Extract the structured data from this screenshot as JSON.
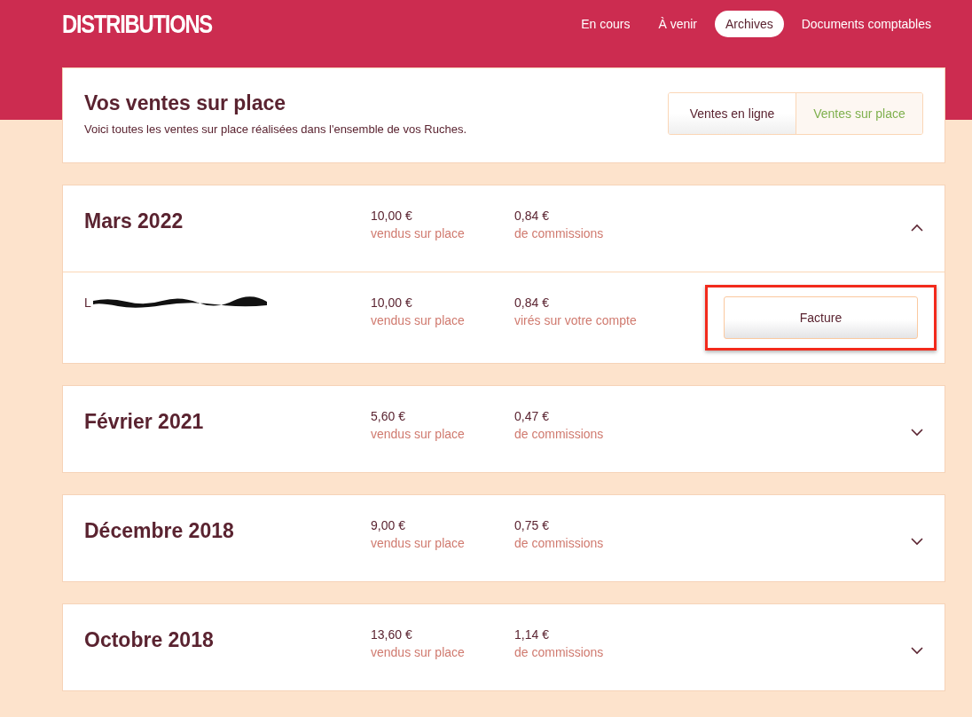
{
  "brand": "DISTRIBUTIONS",
  "nav": [
    {
      "label": "En cours",
      "selected": false
    },
    {
      "label": "À venir",
      "selected": false
    },
    {
      "label": "Archives",
      "selected": true
    },
    {
      "label": "Documents comptables",
      "selected": false
    }
  ],
  "intro": {
    "title": "Vos ventes sur place",
    "text": "Voici toutes les ventes sur place réalisées dans l'ensemble de vos Ruches."
  },
  "channel_toggle": [
    {
      "label": "Ventes en ligne",
      "selected": false
    },
    {
      "label": "Ventes sur place",
      "selected": true
    }
  ],
  "months": [
    {
      "title": "Mars 2022",
      "sales": "10,00 €",
      "sales_label": "vendus sur place",
      "commission": "0,84 €",
      "commission_label": "de commissions",
      "expanded": true,
      "details": [
        {
          "name": "L",
          "redacted": true,
          "sales": "10,00 €",
          "sales_label": "vendus sur place",
          "commission": "0,84 €",
          "commission_label": "virés sur votre compte",
          "button": "Facture",
          "highlighted": true
        }
      ]
    },
    {
      "title": "Février 2021",
      "sales": "5,60 €",
      "sales_label": "vendus sur place",
      "commission": "0,47 €",
      "commission_label": "de commissions",
      "expanded": false
    },
    {
      "title": "Décembre 2018",
      "sales": "9,00 €",
      "sales_label": "vendus sur place",
      "commission": "0,75 €",
      "commission_label": "de commissions",
      "expanded": false
    },
    {
      "title": "Octobre 2018",
      "sales": "13,60 €",
      "sales_label": "vendus sur place",
      "commission": "1,14 €",
      "commission_label": "de commissions",
      "expanded": false
    }
  ]
}
